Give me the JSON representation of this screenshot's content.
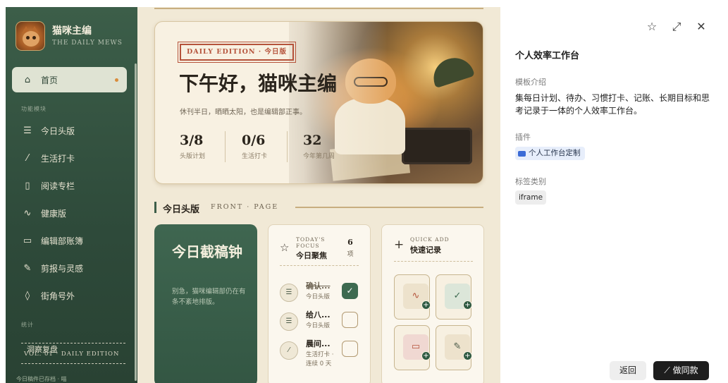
{
  "sidebar": {
    "brand_title": "猫咪主编",
    "brand_sub": "THE DAILY MEWS",
    "section_features": "功能模块",
    "section_stats": "统计",
    "items": [
      {
        "label": "首页",
        "icon": "home-icon",
        "glyph": "⌂"
      },
      {
        "label": "今日头版",
        "icon": "list-icon",
        "glyph": "☰"
      },
      {
        "label": "生活打卡",
        "icon": "leaf-icon",
        "glyph": "⁄"
      },
      {
        "label": "阅读专栏",
        "icon": "book-icon",
        "glyph": "▯"
      },
      {
        "label": "健康版",
        "icon": "pulse-icon",
        "glyph": "∿"
      },
      {
        "label": "编辑部账簿",
        "icon": "wallet-icon",
        "glyph": "▭"
      },
      {
        "label": "剪报与灵感",
        "icon": "pen-icon",
        "glyph": "✎"
      },
      {
        "label": "街角号外",
        "icon": "drop-icon",
        "glyph": "◊"
      }
    ],
    "footer_stats_label": "洞察复盘",
    "footer_edition": "VOL. 01 · DAILY EDITION",
    "footer_note": "今日稿件已存档 · 喵"
  },
  "hero": {
    "edition": "DAILY EDITION · 今日版",
    "title": "下午好，猫咪主编",
    "subtitle": "休刊半日，晒晒太阳，也是编辑部正事。",
    "stats": [
      {
        "value": "3/8",
        "label": "头版计划"
      },
      {
        "value": "0/6",
        "label": "生活打卡"
      },
      {
        "value": "32",
        "label": "今年第几周"
      }
    ]
  },
  "front_page": {
    "title_zh": "今日头版",
    "title_en": "FRONT · PAGE"
  },
  "deadline": {
    "title": "今日截稿钟",
    "desc": "别急，猫咪编辑部仍在有条不紊地排版。"
  },
  "focus": {
    "en": "TODAY'S FOCUS",
    "zh": "今日聚焦",
    "count": "6",
    "count_unit": "项",
    "tasks": [
      {
        "name": "确认...",
        "sub": "今日头版",
        "done": true
      },
      {
        "name": "给八...",
        "sub": "今日头版",
        "done": false
      },
      {
        "name": "晨间...",
        "sub": "生活打卡 · 连续 0 天",
        "done": false
      }
    ]
  },
  "quick": {
    "en": "QUICK ADD",
    "zh": "快速记录",
    "items": [
      {
        "icon": "pulse-icon",
        "glyph": "∿",
        "color": "#b5533b",
        "bg": "#ede2cc"
      },
      {
        "icon": "check-icon",
        "glyph": "✓",
        "color": "#3d6a50",
        "bg": "#dce6d9"
      },
      {
        "icon": "wallet-icon",
        "glyph": "▭",
        "color": "#b5533b",
        "bg": "#f0d8d2"
      },
      {
        "icon": "pen-icon",
        "glyph": "✎",
        "color": "#4a5a48",
        "bg": "#ede2cc"
      }
    ]
  },
  "panel": {
    "title": "个人效率工作台",
    "template_label": "模板介绍",
    "template_desc": "集每日计划、待办、习惯打卡、记账、长期目标和思考记录于一体的个人效率工作台。",
    "plugin_label": "插件",
    "plugin_chip": "个人工作台定制",
    "tag_label": "标签类别",
    "tag": "iframe",
    "back_button": "返回",
    "same_button": "做同款",
    "same_icon": "⟋"
  }
}
